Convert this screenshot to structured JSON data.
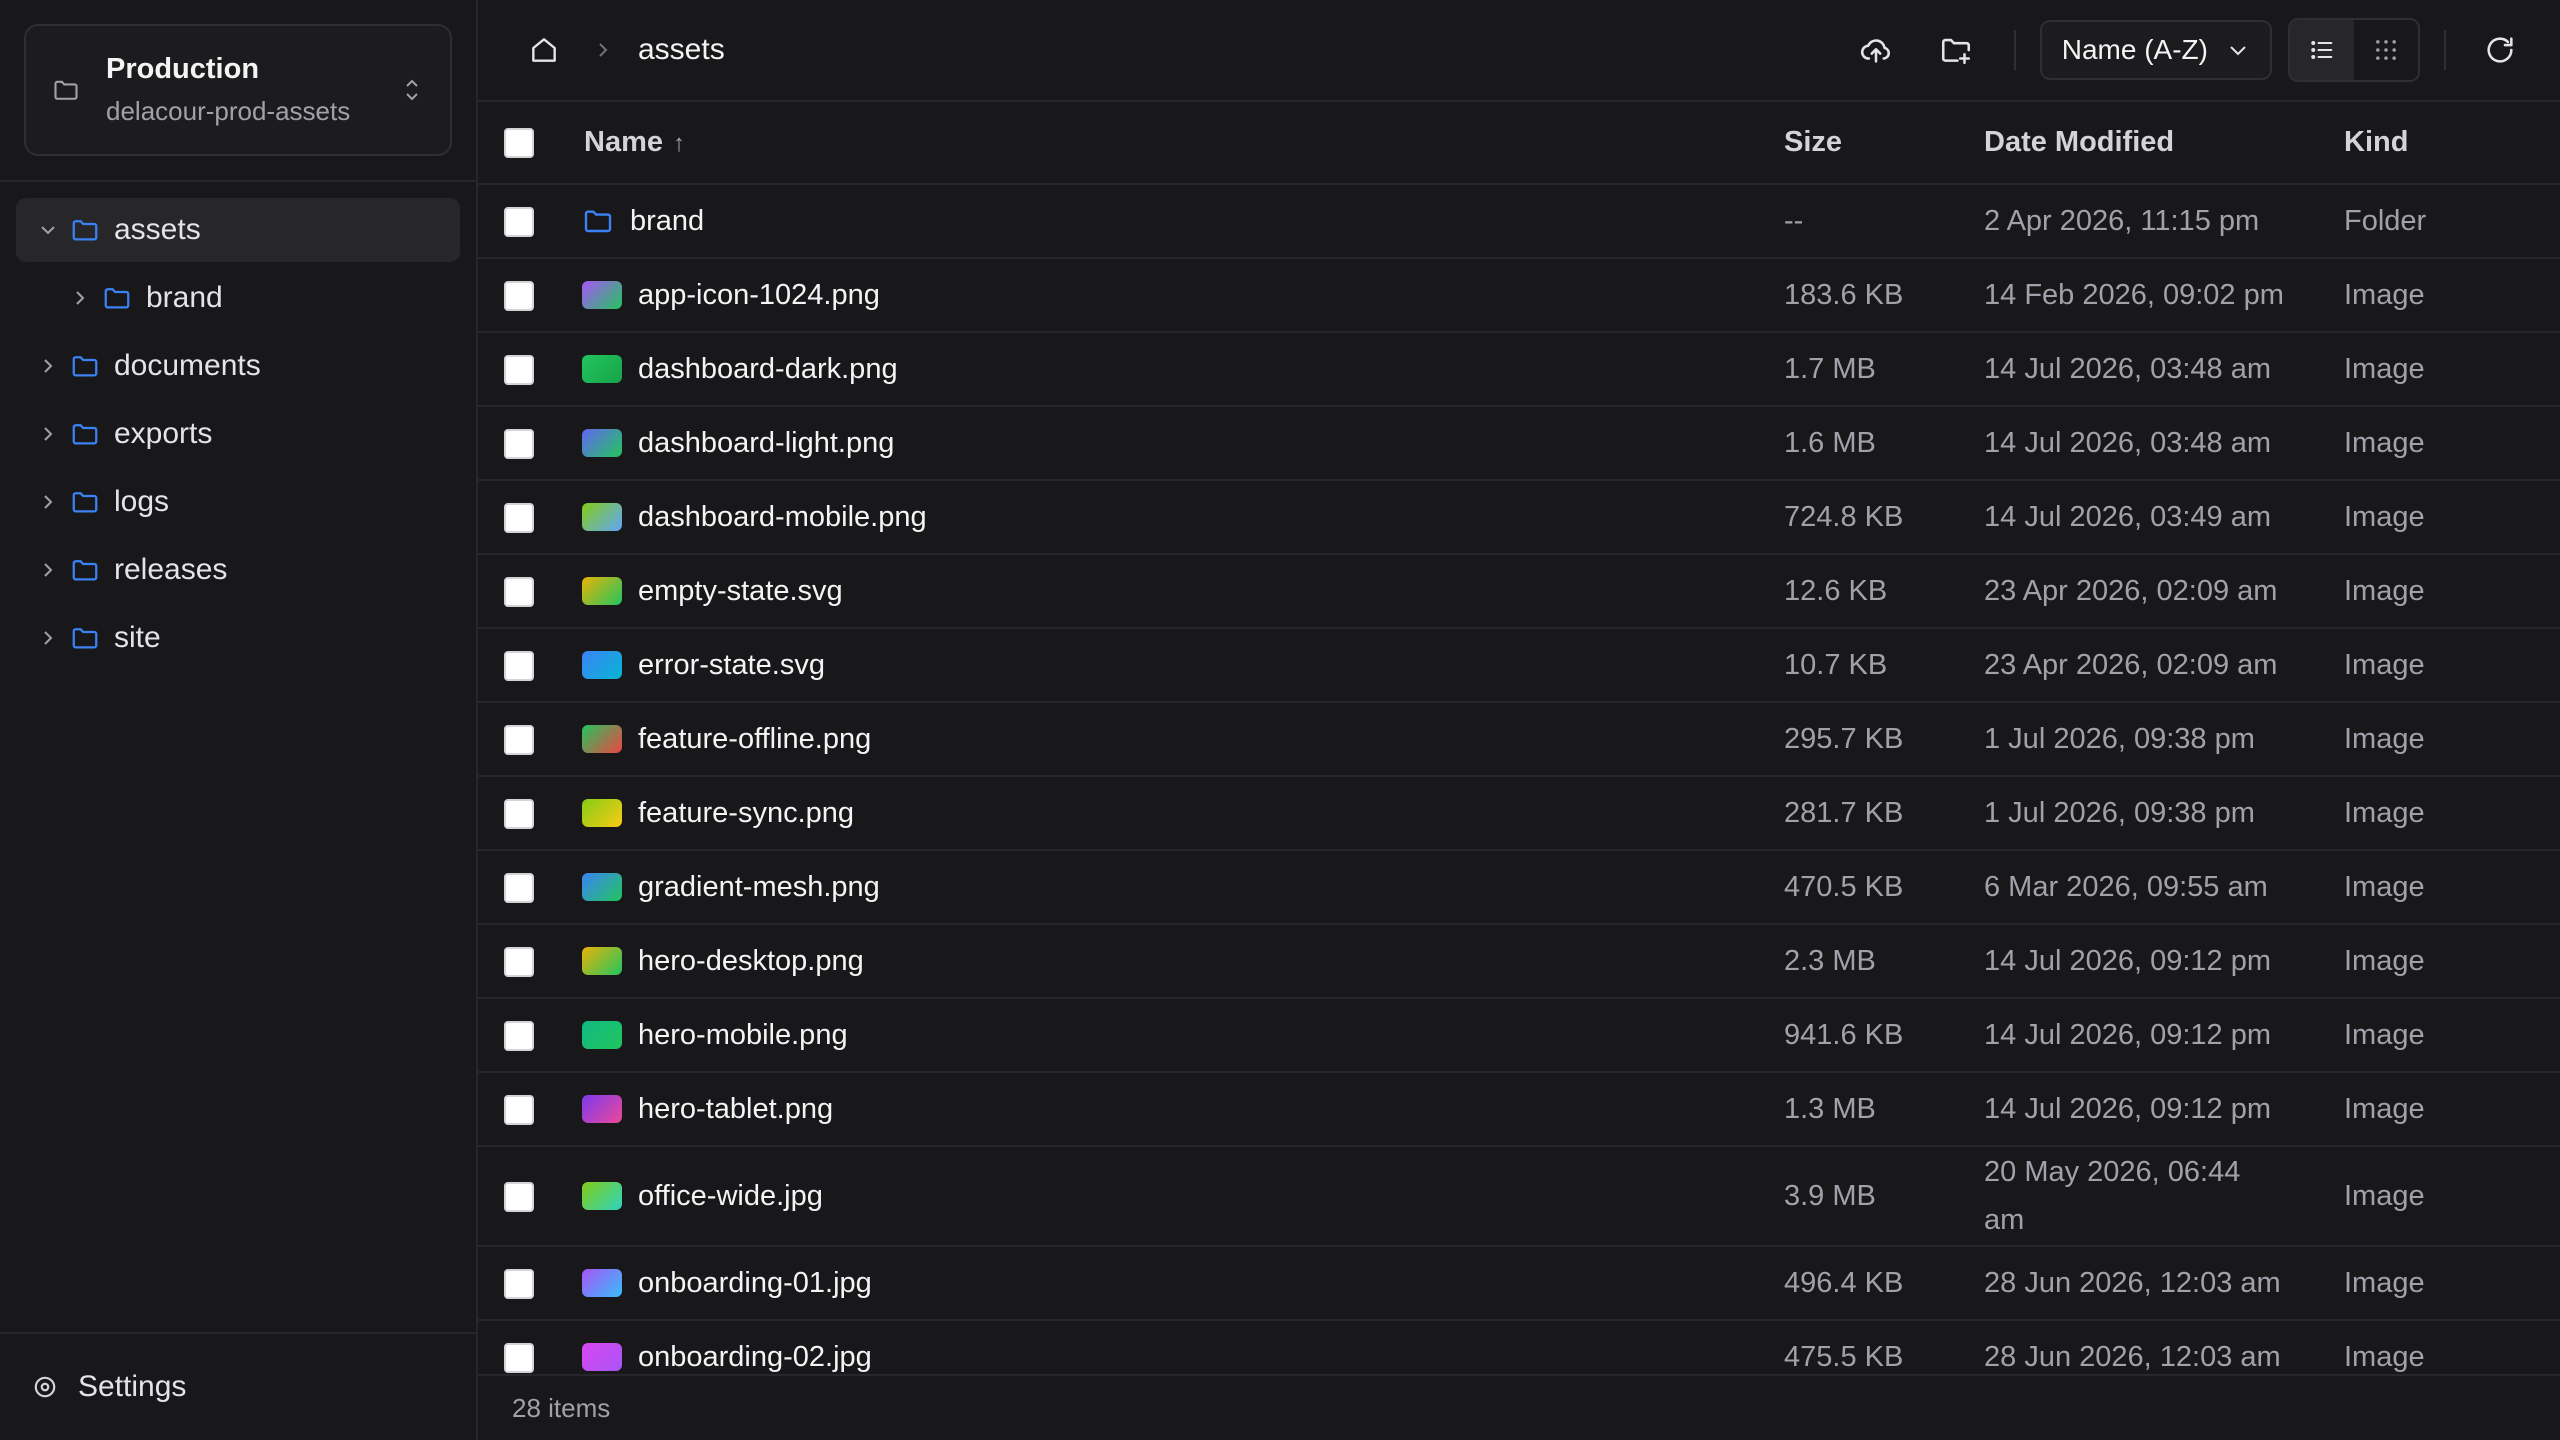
{
  "bucket": {
    "title": "Production",
    "name": "delacour-prod-assets"
  },
  "tree": [
    {
      "label": "assets",
      "expanded": true,
      "active": true
    },
    {
      "label": "brand",
      "child": true
    },
    {
      "label": "documents"
    },
    {
      "label": "exports"
    },
    {
      "label": "logs"
    },
    {
      "label": "releases"
    },
    {
      "label": "site"
    }
  ],
  "settings_label": "Settings",
  "breadcrumb": {
    "current": "assets"
  },
  "toolbar": {
    "sort_label": "Name (A-Z)"
  },
  "table": {
    "headers": {
      "name": "Name",
      "size": "Size",
      "date": "Date Modified",
      "kind": "Kind",
      "sort_arrow": "↑"
    },
    "rows": [
      {
        "name": "brand",
        "size": "--",
        "date": "2 Apr 2026, 11:15 pm",
        "kind": "Folder",
        "type": "folder"
      },
      {
        "name": "app-icon-1024.png",
        "size": "183.6 KB",
        "date": "14 Feb 2026, 09:02 pm",
        "kind": "Image",
        "thumb": [
          "#a855f7",
          "#22c55e"
        ]
      },
      {
        "name": "dashboard-dark.png",
        "size": "1.7 MB",
        "date": "14 Jul 2026, 03:48 am",
        "kind": "Image",
        "thumb": [
          "#22c55e",
          "#16a34a"
        ]
      },
      {
        "name": "dashboard-light.png",
        "size": "1.6 MB",
        "date": "14 Jul 2026, 03:48 am",
        "kind": "Image",
        "thumb": [
          "#6366f1",
          "#22c55e"
        ]
      },
      {
        "name": "dashboard-mobile.png",
        "size": "724.8 KB",
        "date": "14 Jul 2026, 03:49 am",
        "kind": "Image",
        "thumb": [
          "#84cc16",
          "#60a5fa"
        ]
      },
      {
        "name": "empty-state.svg",
        "size": "12.6 KB",
        "date": "23 Apr 2026, 02:09 am",
        "kind": "Image",
        "thumb": [
          "#eab308",
          "#22c55e"
        ]
      },
      {
        "name": "error-state.svg",
        "size": "10.7 KB",
        "date": "23 Apr 2026, 02:09 am",
        "kind": "Image",
        "thumb": [
          "#3b82f6",
          "#06b6d4"
        ]
      },
      {
        "name": "feature-offline.png",
        "size": "295.7 KB",
        "date": "1 Jul 2026, 09:38 pm",
        "kind": "Image",
        "thumb": [
          "#22c55e",
          "#ef4444"
        ]
      },
      {
        "name": "feature-sync.png",
        "size": "281.7 KB",
        "date": "1 Jul 2026, 09:38 pm",
        "kind": "Image",
        "thumb": [
          "#84cc16",
          "#facc15"
        ]
      },
      {
        "name": "gradient-mesh.png",
        "size": "470.5 KB",
        "date": "6 Mar 2026, 09:55 am",
        "kind": "Image",
        "thumb": [
          "#3b82f6",
          "#22c55e"
        ]
      },
      {
        "name": "hero-desktop.png",
        "size": "2.3 MB",
        "date": "14 Jul 2026, 09:12 pm",
        "kind": "Image",
        "thumb": [
          "#eab308",
          "#22c55e"
        ]
      },
      {
        "name": "hero-mobile.png",
        "size": "941.6 KB",
        "date": "14 Jul 2026, 09:12 pm",
        "kind": "Image",
        "thumb": [
          "#10b981",
          "#22c55e"
        ]
      },
      {
        "name": "hero-tablet.png",
        "size": "1.3 MB",
        "date": "14 Jul 2026, 09:12 pm",
        "kind": "Image",
        "thumb": [
          "#7c3aed",
          "#ec4899"
        ]
      },
      {
        "name": "office-wide.jpg",
        "size": "3.9 MB",
        "date": "20 May 2026, 06:44 am",
        "kind": "Image",
        "thumb": [
          "#84cc16",
          "#2dd4bf"
        ],
        "tall": true
      },
      {
        "name": "onboarding-01.jpg",
        "size": "496.4 KB",
        "date": "28 Jun 2026, 12:03 am",
        "kind": "Image",
        "thumb": [
          "#a855f7",
          "#38bdf8"
        ]
      },
      {
        "name": "onboarding-02.jpg",
        "size": "475.5 KB",
        "date": "28 Jun 2026, 12:03 am",
        "kind": "Image",
        "thumb": [
          "#d946ef",
          "#a855f7"
        ]
      }
    ]
  },
  "status": {
    "items": "28 items"
  },
  "colors": {
    "folder": "#3b82f6",
    "bg": "#18181b",
    "border": "#27272a"
  }
}
